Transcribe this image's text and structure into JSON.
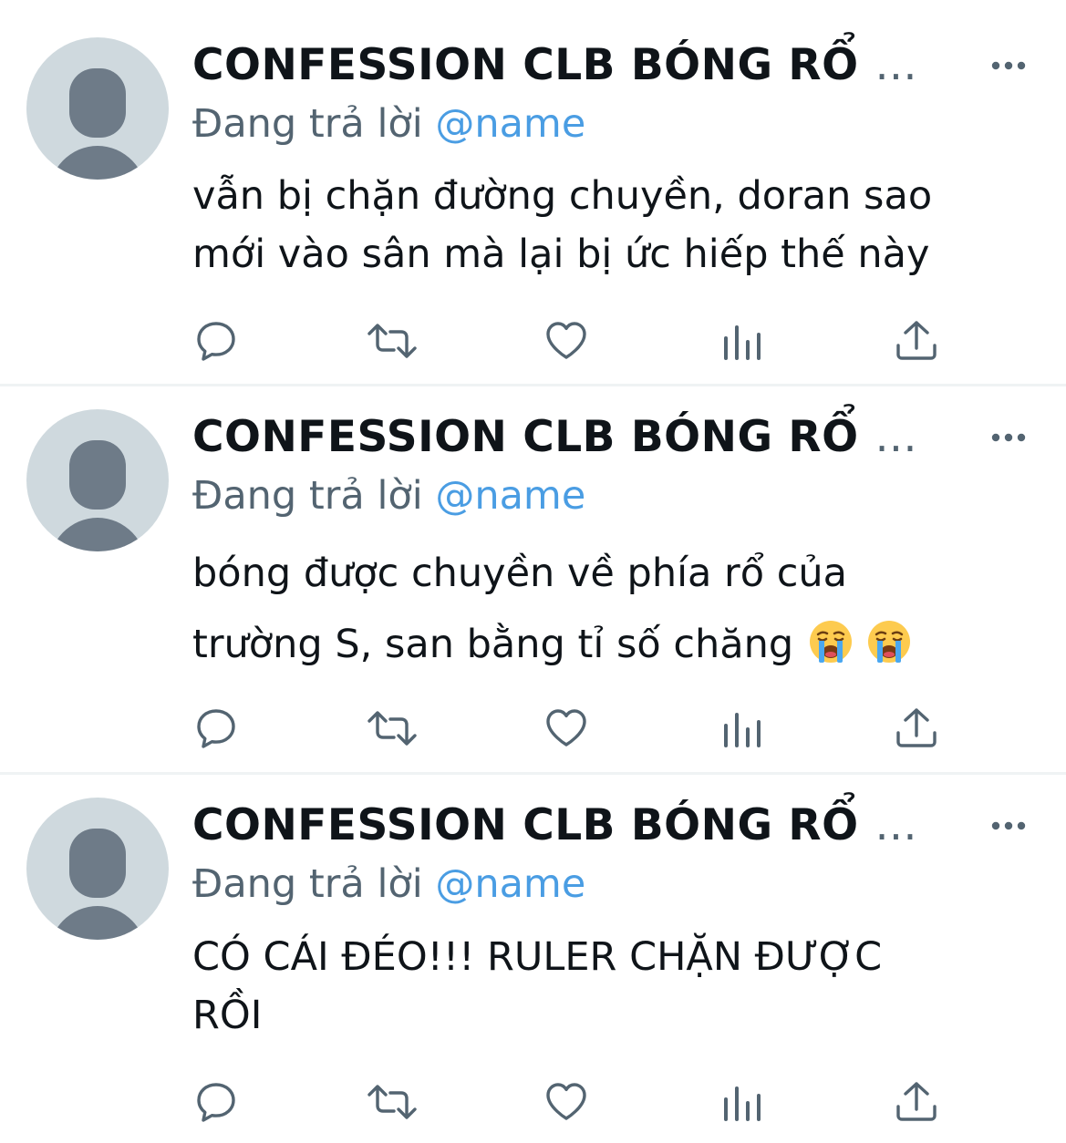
{
  "tweets": [
    {
      "author": "CONFESSION CLB BÓNG RỔ",
      "ellipsis": "...",
      "reply_prefix": "Đang trả lời",
      "reply_handle": "@name",
      "text": "vẫn bị chặn đường chuyền, doran sao\nmới vào sân mà lại bị ức hiếp thế này",
      "emojis": []
    },
    {
      "author": "CONFESSION CLB BÓNG RỔ",
      "ellipsis": "...",
      "reply_prefix": "Đang trả lời",
      "reply_handle": "@name",
      "text": "bóng được chuyền về phía rổ của\ntrường S, san bằng tỉ số chăng",
      "emojis": [
        "loudly-crying-face-icon",
        "loudly-crying-face-icon"
      ]
    },
    {
      "author": "CONFESSION CLB BÓNG RỔ",
      "ellipsis": "...",
      "reply_prefix": "Đang trả lời",
      "reply_handle": "@name",
      "text": "CÓ CÁI ĐÉO!!! RULER CHẶN ĐƯỢC\nRỒI",
      "emojis": []
    }
  ],
  "actions": [
    "reply-icon",
    "retweet-icon",
    "like-icon",
    "views-icon",
    "share-icon"
  ],
  "colors": {
    "text": "#0f1419",
    "secondary": "#536471",
    "handle": "#4a9de3",
    "avatar_bg": "#cfd9de",
    "avatar_fg": "#6e7b88",
    "divider": "#eff3f4"
  }
}
